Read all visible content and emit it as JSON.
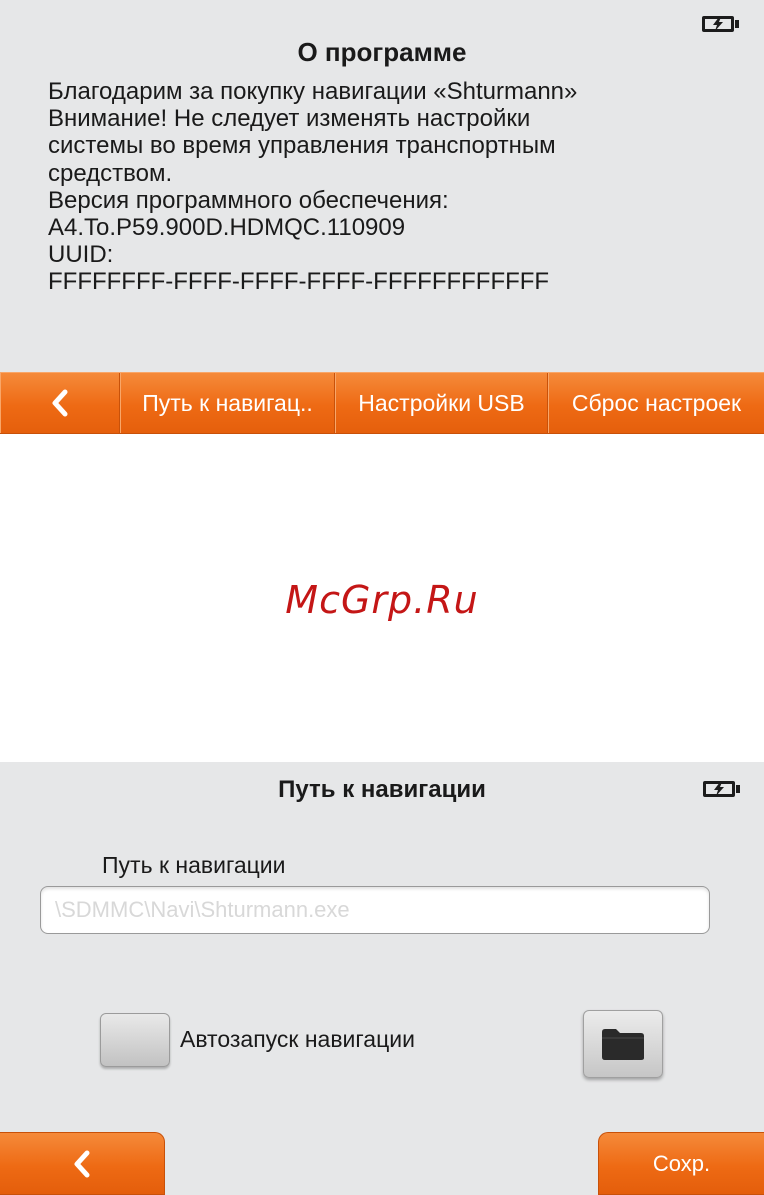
{
  "screen_about": {
    "title": "О программе",
    "lines": [
      "Благодарим за покупку навигации «Shturmann»",
      "Внимание! Не следует изменять настройки",
      "системы во время управления транспортным",
      "средством.",
      "Версия программного обеспечения:",
      "A4.To.P59.900D.HDMQC.110909",
      "UUID:",
      "FFFFFFFF-FFFF-FFFF-FFFF-FFFFFFFFFFFF"
    ],
    "tabs": {
      "path": "Путь к навигац..",
      "usb": "Настройки USB",
      "reset": "Сброс настроек"
    }
  },
  "watermark": "McGrp.Ru",
  "screen_path": {
    "title": "Путь к навигации",
    "field_label": "Путь к навигации",
    "field_value": "\\SDMMC\\Navi\\Shturmann.exe",
    "autostart_label": "Автозапуск навигации",
    "save_label": "Сохр."
  },
  "colors": {
    "accent_orange": "#ee6a14",
    "panel_gray": "#e6e7e8",
    "watermark_red": "#c41616"
  },
  "icons": [
    "battery-charging-icon",
    "chevron-left-icon",
    "folder-icon"
  ]
}
